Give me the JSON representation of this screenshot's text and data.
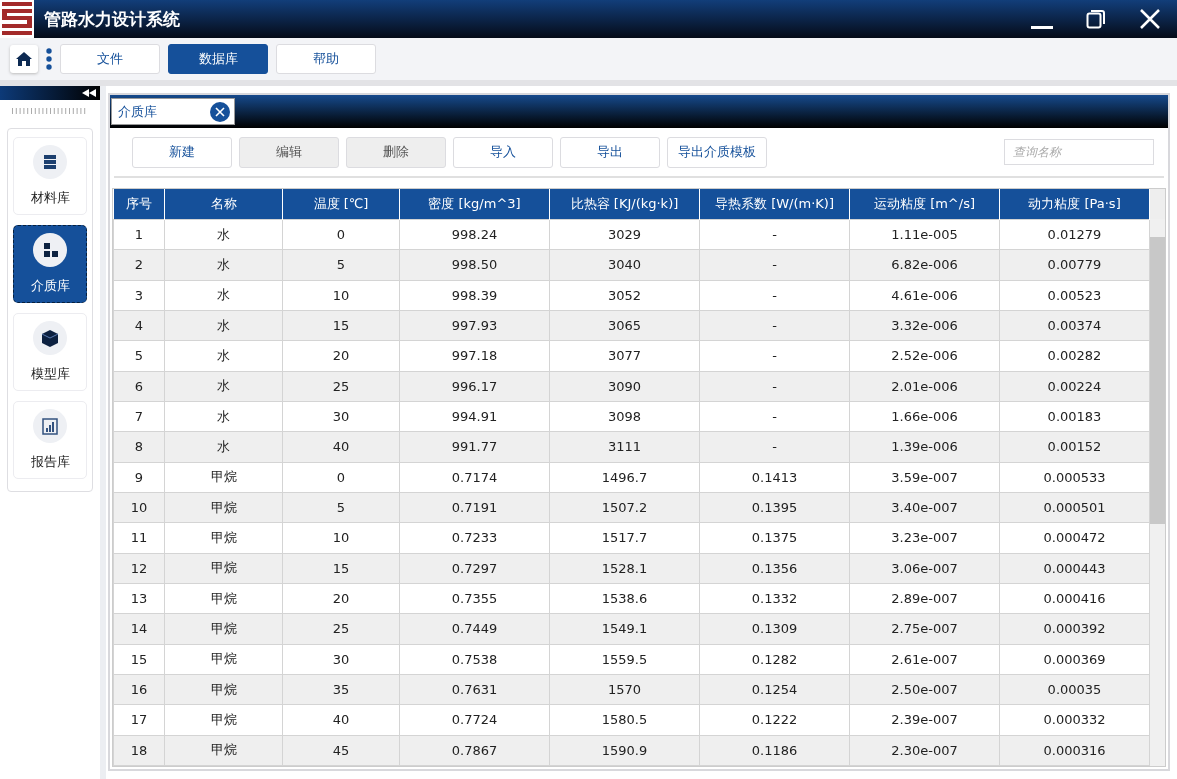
{
  "window": {
    "title": "管路水力设计系统"
  },
  "menu": [
    {
      "label": "文件",
      "selected": false
    },
    {
      "label": "数据库",
      "selected": true
    },
    {
      "label": "帮助",
      "selected": false
    }
  ],
  "sidebar": {
    "items": [
      {
        "label": "材料库",
        "kind": "list",
        "selected": false
      },
      {
        "label": "介质库",
        "kind": "grid",
        "selected": true
      },
      {
        "label": "模型库",
        "kind": "cube",
        "selected": false
      },
      {
        "label": "报告库",
        "kind": "report",
        "selected": false
      }
    ]
  },
  "doc_tab": {
    "label": "介质库"
  },
  "toolbar": [
    {
      "label": "新建",
      "disabled": false
    },
    {
      "label": "编辑",
      "disabled": true
    },
    {
      "label": "删除",
      "disabled": true
    },
    {
      "label": "导入",
      "disabled": false
    },
    {
      "label": "导出",
      "disabled": false
    },
    {
      "label": "导出介质模板",
      "disabled": false
    }
  ],
  "search": {
    "placeholder": "查询名称"
  },
  "table": {
    "columns": [
      "序号",
      "名称",
      "温度 [℃]",
      "密度 [kg/m^3]",
      "比热容 [KJ/(kg·k)]",
      "导热系数 [W/(m·K)]",
      "运动粘度 [m^/s]",
      "动力粘度 [Pa·s]"
    ],
    "rows": [
      [
        "1",
        "水",
        "0",
        "998.24",
        "3029",
        "-",
        "1.11e-005",
        "0.01279"
      ],
      [
        "2",
        "水",
        "5",
        "998.50",
        "3040",
        "-",
        "6.82e-006",
        "0.00779"
      ],
      [
        "3",
        "水",
        "10",
        "998.39",
        "3052",
        "-",
        "4.61e-006",
        "0.00523"
      ],
      [
        "4",
        "水",
        "15",
        "997.93",
        "3065",
        "-",
        "3.32e-006",
        "0.00374"
      ],
      [
        "5",
        "水",
        "20",
        "997.18",
        "3077",
        "-",
        "2.52e-006",
        "0.00282"
      ],
      [
        "6",
        "水",
        "25",
        "996.17",
        "3090",
        "-",
        "2.01e-006",
        "0.00224"
      ],
      [
        "7",
        "水",
        "30",
        "994.91",
        "3098",
        "-",
        "1.66e-006",
        "0.00183"
      ],
      [
        "8",
        "水",
        "40",
        "991.77",
        "3111",
        "-",
        "1.39e-006",
        "0.00152"
      ],
      [
        "9",
        "甲烷",
        "0",
        "0.7174",
        "1496.7",
        "0.1413",
        "3.59e-007",
        "0.000533"
      ],
      [
        "10",
        "甲烷",
        "5",
        "0.7191",
        "1507.2",
        "0.1395",
        "3.40e-007",
        "0.000501"
      ],
      [
        "11",
        "甲烷",
        "10",
        "0.7233",
        "1517.7",
        "0.1375",
        "3.23e-007",
        "0.000472"
      ],
      [
        "12",
        "甲烷",
        "15",
        "0.7297",
        "1528.1",
        "0.1356",
        "3.06e-007",
        "0.000443"
      ],
      [
        "13",
        "甲烷",
        "20",
        "0.7355",
        "1538.6",
        "0.1332",
        "2.89e-007",
        "0.000416"
      ],
      [
        "14",
        "甲烷",
        "25",
        "0.7449",
        "1549.1",
        "0.1309",
        "2.75e-007",
        "0.000392"
      ],
      [
        "15",
        "甲烷",
        "30",
        "0.7538",
        "1559.5",
        "0.1282",
        "2.61e-007",
        "0.000369"
      ],
      [
        "16",
        "甲烷",
        "35",
        "0.7631",
        "1570",
        "0.1254",
        "2.50e-007",
        "0.00035"
      ],
      [
        "17",
        "甲烷",
        "40",
        "0.7724",
        "1580.5",
        "0.1222",
        "2.39e-007",
        "0.000332"
      ],
      [
        "18",
        "甲烷",
        "45",
        "0.7867",
        "1590.9",
        "0.1186",
        "2.30e-007",
        "0.000316"
      ]
    ]
  }
}
